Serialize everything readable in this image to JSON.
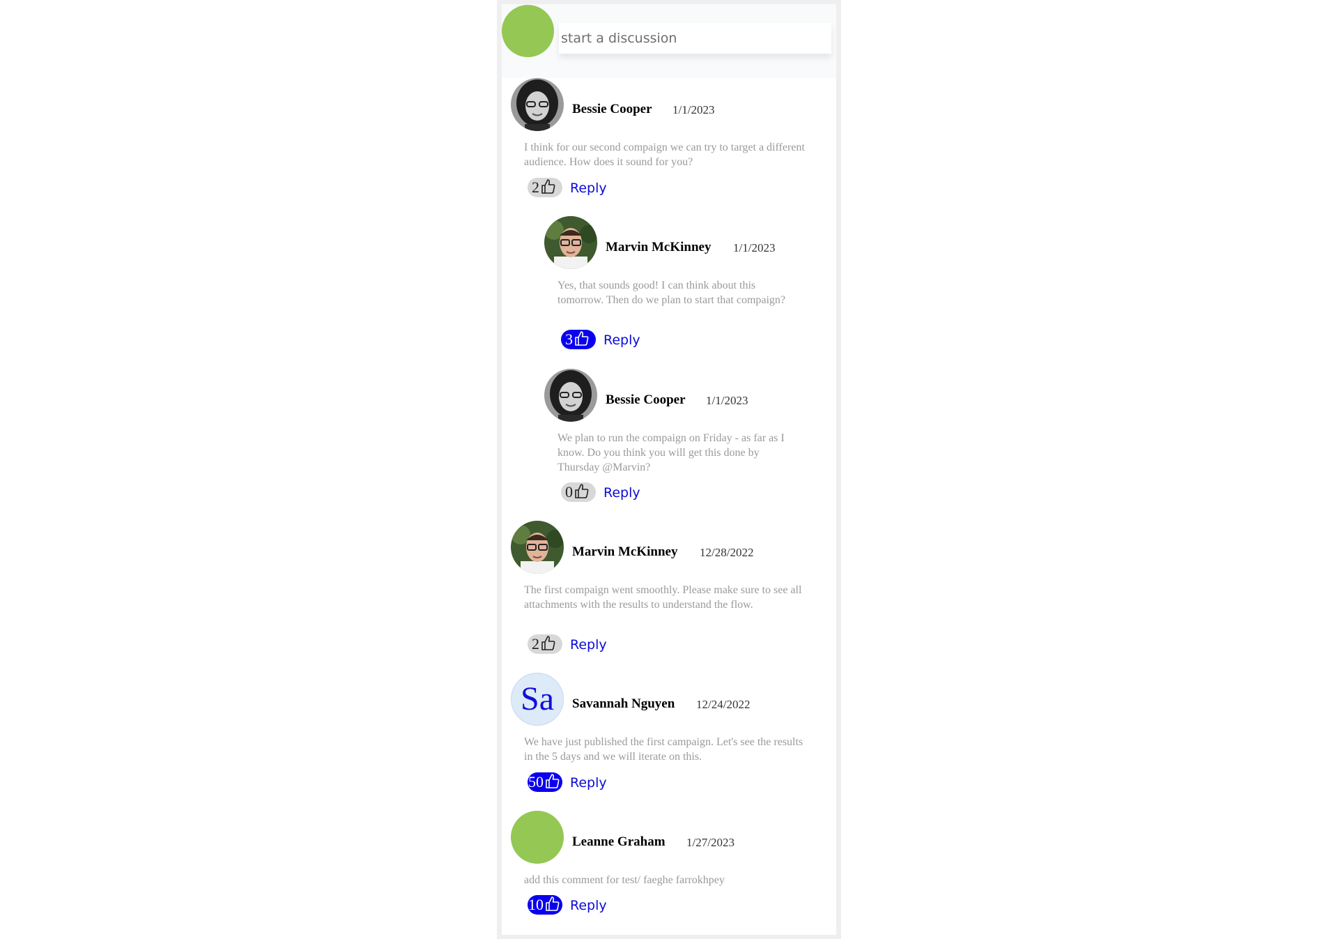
{
  "composer": {
    "placeholder": "start a discussion"
  },
  "reply_label": "Reply",
  "comments": [
    {
      "author": "Bessie Cooper",
      "date": "1/1/2023",
      "text": "I think for our second compaign we can try to target a different audience. How does it sound for you?",
      "likes": "2",
      "liked": false,
      "avatar": "photo-woman"
    },
    {
      "author": "Marvin McKinney",
      "date": "1/1/2023",
      "text": "Yes, that sounds good! I can think about this tomorrow. Then do we plan to start that compaign?",
      "likes": "3",
      "liked": true,
      "avatar": "photo-man"
    },
    {
      "author": "Bessie Cooper",
      "date": "1/1/2023",
      "text": "We plan to run the compaign on Friday - as far as I know. Do you think you will get this done by Thursday @Marvin?",
      "likes": "0",
      "liked": false,
      "avatar": "photo-woman"
    },
    {
      "author": "Marvin McKinney",
      "date": "12/28/2022",
      "text": "The first compaign went smoothly. Please make sure to see all attachments with the results to understand the flow.",
      "likes": "2",
      "liked": false,
      "avatar": "photo-man"
    },
    {
      "author": "Savannah Nguyen",
      "date": "12/24/2022",
      "text": "We have just published the first campaign. Let's see the results in the 5 days and we will iterate on this.",
      "likes": "50",
      "liked": true,
      "avatar": "initials",
      "initials": "Sa"
    },
    {
      "author": "Leanne Graham",
      "date": "1/27/2023",
      "text": "add this comment for test/ faeghe farrokhpey",
      "likes": "10",
      "liked": true,
      "avatar": "green-circle"
    }
  ],
  "colors": {
    "accent": "#0b00ee",
    "reply": "#0b0bd8",
    "avatar_green": "#94c754"
  }
}
